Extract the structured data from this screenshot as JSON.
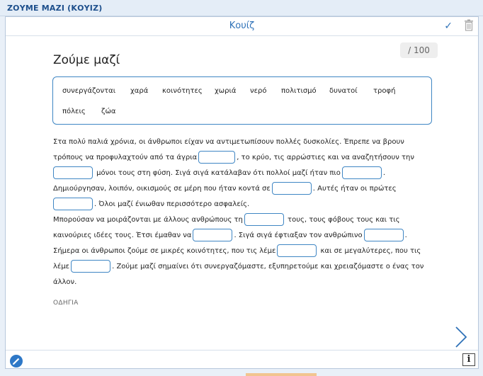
{
  "app": {
    "title": "ΖΟΥΜΕ ΜΑΖΙ (ΚΟΥΙΖ)"
  },
  "header": {
    "title": "Κουίζ"
  },
  "score": {
    "label": "/ 100"
  },
  "quiz": {
    "heading": "Ζούμε μαζί"
  },
  "word_bank": [
    "συνεργάζονται",
    "χαρά",
    "κοινότητες",
    "χωριά",
    "νερό",
    "πολιτισμό",
    "δυνατοί",
    "τροφή",
    "πόλεις",
    "ζώα"
  ],
  "text_lines": [
    [
      "Στα πολύ παλιά χρόνια, οι άνθρωποι είχαν να αντιμετωπίσουν πολλές δυσκολίες. Έπρεπε να βρουν"
    ],
    [
      "τρόπους να προφυλαχτούν από τα άγρια",
      ", το κρύο, τις αρρώστιες και να αναζητήσουν την"
    ],
    [
      "",
      " μόνοι τους στη φύση. Σιγά σιγά κατάλαβαν ότι πολλοί μαζί ήταν πιο",
      "."
    ],
    [
      "Δημιούργησαν, λοιπόν, οικισμούς σε μέρη που ήταν κοντά σε",
      ". Αυτές ήταν οι πρώτες"
    ],
    [
      "",
      ". Όλοι μαζί ένιωθαν περισσότερο ασφαλείς."
    ],
    [
      "Μπορούσαν να μοιράζονται με άλλους ανθρώπους τη",
      " τους, τους φόβους τους και τις"
    ],
    [
      "καινούριες ιδέες τους. Έτσι έμαθαν να",
      ". Σιγά σιγά έφτιαξαν τον ανθρώπινο",
      "."
    ],
    [
      "Σήμερα οι άνθρωποι ζούμε σε μικρές κοινότητες, που τις λέμε",
      " και σε μεγαλύτερες, που τις"
    ],
    [
      "λέμε",
      ". Ζούμε μαζί σημαίνει ότι συνεργαζόμαστε, εξυπηρετούμε και χρειαζόμαστε ο ένας τον"
    ],
    [
      "άλλον."
    ]
  ],
  "instructions": {
    "label": "ΟΔΗΓΙΑ"
  },
  "icons": {
    "check": "check-icon",
    "trash": "trash-icon",
    "next": "chevron-right-icon",
    "edit": "pencil-icon",
    "info": "info-icon"
  },
  "colors": {
    "accent": "#2f72b8",
    "border": "#3f86c4"
  }
}
